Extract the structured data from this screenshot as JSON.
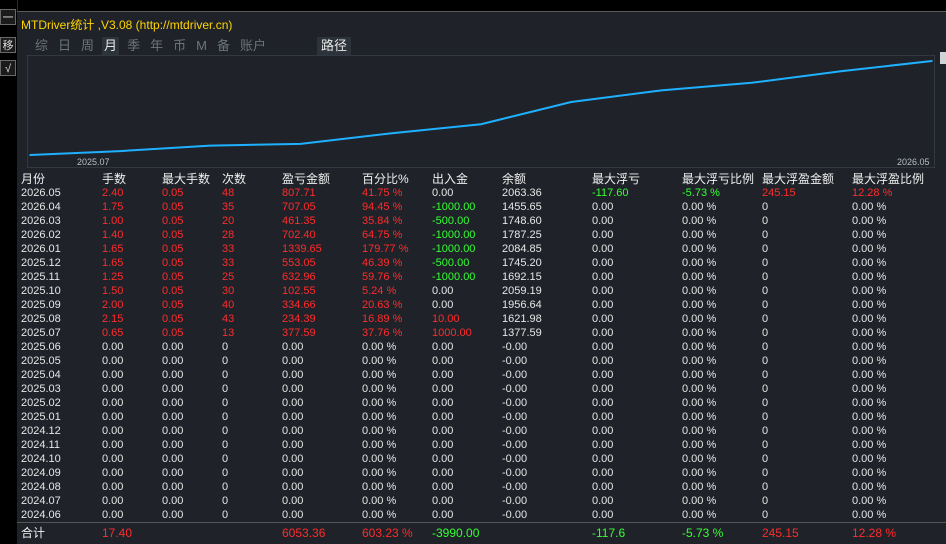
{
  "left_strip": {
    "minimize_label": "一",
    "button2_label": "移",
    "button3_label": "√"
  },
  "title": "MTDriver统计 ,V3.08 (http://mtdriver.cn)",
  "tabs": [
    {
      "label": "综",
      "active": false
    },
    {
      "label": "日",
      "active": false
    },
    {
      "label": "周",
      "active": false
    },
    {
      "label": "月",
      "active": true
    },
    {
      "label": "季",
      "active": false
    },
    {
      "label": "年",
      "active": false
    },
    {
      "label": "币",
      "active": false
    },
    {
      "label": "M",
      "active": false
    },
    {
      "label": "备",
      "active": false
    },
    {
      "label": "账户",
      "active": false
    }
  ],
  "path_button": "路径",
  "chart_data": {
    "type": "line",
    "x": [
      "2025.07",
      "2025.08",
      "2025.09",
      "2025.10",
      "2025.11",
      "2025.12",
      "2026.01",
      "2026.02",
      "2026.03",
      "2026.04",
      "2026.05"
    ],
    "series": [
      {
        "values": [
          377.59,
          611.98,
          946.64,
          1049.19,
          1682.15,
          2235.2,
          3574.85,
          4277.25,
          4738.6,
          5445.65,
          6053.36
        ]
      }
    ],
    "xtick_labels": [
      "2025.07",
      "2026.05"
    ],
    "line_color": "#1fb0ff",
    "grid": false
  },
  "table": {
    "headers": [
      "月份",
      "手数",
      "最大手数",
      "次数",
      "盈亏金额",
      "百分比%",
      "出入金",
      "余额",
      "最大浮亏",
      "最大浮亏比例",
      "最大浮盈金额",
      "最大浮盈比例"
    ],
    "rows": [
      [
        "2026.05",
        "2.40",
        "0.05",
        "48",
        "807.71",
        "41.75 %",
        "0.00",
        "2063.36",
        "-117.60",
        "-5.73 %",
        "245.15",
        "12.28 %"
      ],
      [
        "2026.04",
        "1.75",
        "0.05",
        "35",
        "707.05",
        "94.45 %",
        "-1000.00",
        "1455.65",
        "0.00",
        "0.00 %",
        "0",
        "0.00 %"
      ],
      [
        "2026.03",
        "1.00",
        "0.05",
        "20",
        "461.35",
        "35.84 %",
        "-500.00",
        "1748.60",
        "0.00",
        "0.00 %",
        "0",
        "0.00 %"
      ],
      [
        "2026.02",
        "1.40",
        "0.05",
        "28",
        "702.40",
        "64.75 %",
        "-1000.00",
        "1787.25",
        "0.00",
        "0.00 %",
        "0",
        "0.00 %"
      ],
      [
        "2026.01",
        "1.65",
        "0.05",
        "33",
        "1339.65",
        "179.77 %",
        "-1000.00",
        "2084.85",
        "0.00",
        "0.00 %",
        "0",
        "0.00 %"
      ],
      [
        "2025.12",
        "1.65",
        "0.05",
        "33",
        "553.05",
        "46.39 %",
        "-500.00",
        "1745.20",
        "0.00",
        "0.00 %",
        "0",
        "0.00 %"
      ],
      [
        "2025.11",
        "1.25",
        "0.05",
        "25",
        "632.96",
        "59.76 %",
        "-1000.00",
        "1692.15",
        "0.00",
        "0.00 %",
        "0",
        "0.00 %"
      ],
      [
        "2025.10",
        "1.50",
        "0.05",
        "30",
        "102.55",
        "5.24 %",
        "0.00",
        "2059.19",
        "0.00",
        "0.00 %",
        "0",
        "0.00 %"
      ],
      [
        "2025.09",
        "2.00",
        "0.05",
        "40",
        "334.66",
        "20.63 %",
        "0.00",
        "1956.64",
        "0.00",
        "0.00 %",
        "0",
        "0.00 %"
      ],
      [
        "2025.08",
        "2.15",
        "0.05",
        "43",
        "234.39",
        "16.89 %",
        "10.00",
        "1621.98",
        "0.00",
        "0.00 %",
        "0",
        "0.00 %"
      ],
      [
        "2025.07",
        "0.65",
        "0.05",
        "13",
        "377.59",
        "37.76 %",
        "1000.00",
        "1377.59",
        "0.00",
        "0.00 %",
        "0",
        "0.00 %"
      ],
      [
        "2025.06",
        "0.00",
        "0.00",
        "0",
        "0.00",
        "0.00 %",
        "0.00",
        "-0.00",
        "0.00",
        "0.00 %",
        "0",
        "0.00 %"
      ],
      [
        "2025.05",
        "0.00",
        "0.00",
        "0",
        "0.00",
        "0.00 %",
        "0.00",
        "-0.00",
        "0.00",
        "0.00 %",
        "0",
        "0.00 %"
      ],
      [
        "2025.04",
        "0.00",
        "0.00",
        "0",
        "0.00",
        "0.00 %",
        "0.00",
        "-0.00",
        "0.00",
        "0.00 %",
        "0",
        "0.00 %"
      ],
      [
        "2025.03",
        "0.00",
        "0.00",
        "0",
        "0.00",
        "0.00 %",
        "0.00",
        "-0.00",
        "0.00",
        "0.00 %",
        "0",
        "0.00 %"
      ],
      [
        "2025.02",
        "0.00",
        "0.00",
        "0",
        "0.00",
        "0.00 %",
        "0.00",
        "-0.00",
        "0.00",
        "0.00 %",
        "0",
        "0.00 %"
      ],
      [
        "2025.01",
        "0.00",
        "0.00",
        "0",
        "0.00",
        "0.00 %",
        "0.00",
        "-0.00",
        "0.00",
        "0.00 %",
        "0",
        "0.00 %"
      ],
      [
        "2024.12",
        "0.00",
        "0.00",
        "0",
        "0.00",
        "0.00 %",
        "0.00",
        "-0.00",
        "0.00",
        "0.00 %",
        "0",
        "0.00 %"
      ],
      [
        "2024.11",
        "0.00",
        "0.00",
        "0",
        "0.00",
        "0.00 %",
        "0.00",
        "-0.00",
        "0.00",
        "0.00 %",
        "0",
        "0.00 %"
      ],
      [
        "2024.10",
        "0.00",
        "0.00",
        "0",
        "0.00",
        "0.00 %",
        "0.00",
        "-0.00",
        "0.00",
        "0.00 %",
        "0",
        "0.00 %"
      ],
      [
        "2024.09",
        "0.00",
        "0.00",
        "0",
        "0.00",
        "0.00 %",
        "0.00",
        "-0.00",
        "0.00",
        "0.00 %",
        "0",
        "0.00 %"
      ],
      [
        "2024.08",
        "0.00",
        "0.00",
        "0",
        "0.00",
        "0.00 %",
        "0.00",
        "-0.00",
        "0.00",
        "0.00 %",
        "0",
        "0.00 %"
      ],
      [
        "2024.07",
        "0.00",
        "0.00",
        "0",
        "0.00",
        "0.00 %",
        "0.00",
        "-0.00",
        "0.00",
        "0.00 %",
        "0",
        "0.00 %"
      ],
      [
        "2024.06",
        "0.00",
        "0.00",
        "0",
        "0.00",
        "0.00 %",
        "0.00",
        "-0.00",
        "0.00",
        "0.00 %",
        "0",
        "0.00 %"
      ]
    ],
    "total": {
      "label": "合计",
      "lots": "17.40",
      "profit": "6053.36",
      "percent": "603.23 %",
      "deposit": "-3990.00",
      "max_drawdown": "-117.6",
      "max_drawdown_pct": "-5.73 %",
      "max_float_profit": "245.15",
      "max_float_profit_pct": "12.28 %"
    }
  },
  "colors": {
    "positive": "#ff2b2b",
    "negative": "#33ff33",
    "neutral": "#e6e6e6",
    "title": "#ffd400"
  }
}
